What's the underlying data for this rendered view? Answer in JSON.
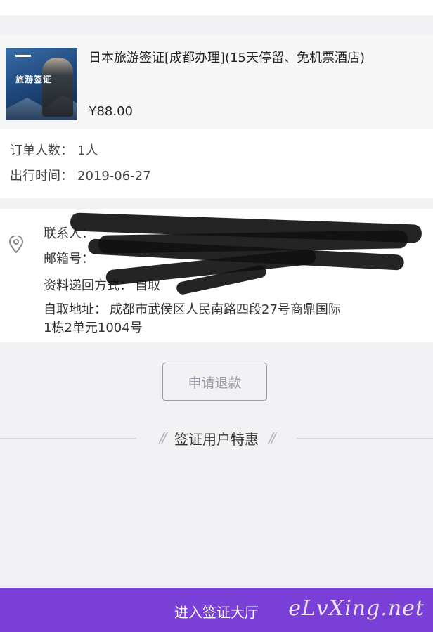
{
  "product": {
    "thumbnail_text": "旅游签证",
    "title": "日本旅游签证[成都办理](15天停留、免机票酒店)",
    "price": "¥88.00"
  },
  "order": {
    "people_label": "订单人数：",
    "people_value": "1人",
    "date_label": "出行时间：",
    "date_value": "2019-06-27"
  },
  "contact": {
    "name_label": "联系人：",
    "email_label": "邮箱号：",
    "delivery_label": "资料递回方式：",
    "delivery_value": "自取",
    "address_label": "自取地址：",
    "address_line1": "成都市武侯区人民南路四段27号商鼎国际",
    "address_line2": "1栋2单元1004号"
  },
  "refund_button": "申请退款",
  "deals_title": "签证用户特惠",
  "bottom_button": "进入签证大厅",
  "watermark": "eLvXing.net",
  "colors": {
    "accent": "#7a3fd6",
    "background": "#f2f2f4"
  }
}
